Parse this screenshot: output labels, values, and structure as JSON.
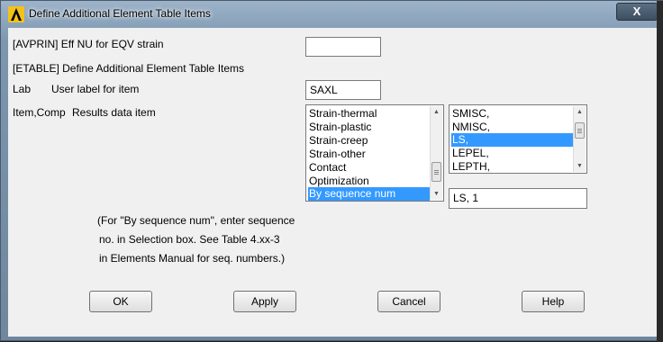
{
  "window": {
    "title": "Define Additional Element Table Items",
    "close_label": "X"
  },
  "avprin": {
    "label": "[AVPRIN]  Eff NU for EQV strain",
    "value": ""
  },
  "etable": {
    "label": "[ETABLE]  Define Additional Element Table Items"
  },
  "lab": {
    "label_key": "Lab",
    "label_desc": "User label for item",
    "value": "SAXL"
  },
  "item_comp": {
    "label_key": "Item,Comp",
    "label_desc": "Results data item",
    "left_list": [
      "Strain-thermal",
      "Strain-plastic",
      "Strain-creep",
      "Strain-other",
      "Contact",
      "Optimization",
      "By sequence num"
    ],
    "left_selected": "By sequence num",
    "right_list": [
      "SMISC,",
      "NMISC,",
      "LS,",
      "LEPEL,",
      "LEPTH,"
    ],
    "right_selected": "LS,",
    "selection_value": "LS, 1"
  },
  "note": {
    "line1": "(For \"By sequence num\", enter sequence",
    "line2": "no. in Selection box.  See Table 4.xx-3",
    "line3": "in Elements Manual for seq. numbers.)"
  },
  "buttons": {
    "ok": "OK",
    "apply": "Apply",
    "cancel": "Cancel",
    "help": "Help"
  }
}
